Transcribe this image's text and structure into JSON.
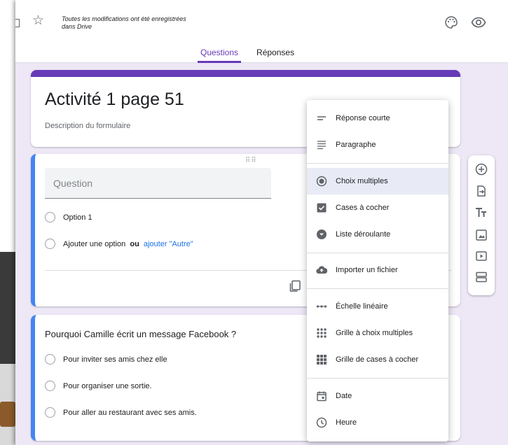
{
  "header": {
    "save_status": "Toutes les modifications ont été enregistrées dans Drive",
    "tabs": [
      {
        "label": "Questions",
        "active": true
      },
      {
        "label": "Réponses",
        "active": false
      }
    ]
  },
  "form": {
    "title": "Activité 1 page 51",
    "description_placeholder": "Description du formulaire"
  },
  "question_editor": {
    "placeholder": "Question",
    "option_1": "Option 1",
    "add_option": "Ajouter une option",
    "or_label": "ou",
    "add_other": "ajouter \"Autre\""
  },
  "question_2": {
    "title": "Pourquoi Camille écrit un message Facebook ?",
    "options": [
      "Pour inviter ses amis chez elle",
      "Pour organiser une sortie.",
      "Pour aller au restaurant avec ses amis."
    ]
  },
  "question_type_menu": {
    "items": [
      {
        "label": "Réponse courte",
        "icon": "short-answer-icon"
      },
      {
        "label": "Paragraphe",
        "icon": "paragraph-icon"
      },
      {
        "label": "Choix multiples",
        "icon": "radio-icon",
        "selected": true
      },
      {
        "label": "Cases à cocher",
        "icon": "checkbox-icon"
      },
      {
        "label": "Liste déroulante",
        "icon": "dropdown-icon"
      },
      {
        "label": "Importer un fichier",
        "icon": "cloud-upload-icon"
      },
      {
        "label": "Échelle linéaire",
        "icon": "linear-scale-icon"
      },
      {
        "label": "Grille à choix multiples",
        "icon": "grid-icon"
      },
      {
        "label": "Grille de cases à cocher",
        "icon": "checkbox-grid-icon"
      },
      {
        "label": "Date",
        "icon": "calendar-icon"
      },
      {
        "label": "Heure",
        "icon": "clock-icon"
      }
    ]
  },
  "colors": {
    "accent": "#673ab7",
    "question_bar": "#4285f4",
    "link": "#1a73e8",
    "background": "#ede7f6",
    "menu_selected": "#e8eaf6"
  }
}
